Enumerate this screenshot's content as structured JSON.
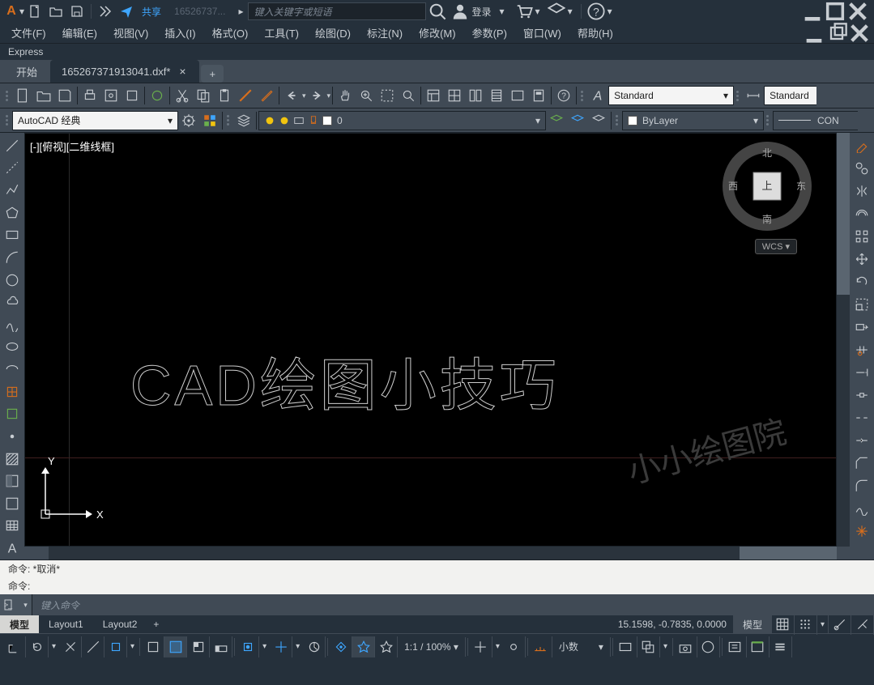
{
  "top": {
    "share": "共享",
    "filename": "16526737...",
    "search_placeholder": "键入关键字或短语",
    "login": "登录"
  },
  "menu": {
    "file": "文件(F)",
    "edit": "编辑(E)",
    "view": "视图(V)",
    "insert": "插入(I)",
    "format": "格式(O)",
    "tools": "工具(T)",
    "draw": "绘图(D)",
    "dimension": "标注(N)",
    "modify": "修改(M)",
    "parametric": "参数(P)",
    "window": "窗口(W)",
    "help": "帮助(H)"
  },
  "express": "Express",
  "tabs": {
    "start": "开始",
    "active": "165267371913041.dxf*"
  },
  "styles": {
    "text": "Standard",
    "dim": "Standard"
  },
  "workspace": "AutoCAD 经典",
  "layer": "0",
  "bylayer": "ByLayer",
  "linetype": "CON",
  "view": {
    "label": "[-][俯视][二维线框]",
    "north": "北",
    "south": "南",
    "east": "东",
    "west": "西",
    "top": "上",
    "x": "X",
    "y": "Y",
    "wcs": "WCS ▾"
  },
  "canvas_text": "CAD绘图小技巧",
  "watermark": "小小绘图院",
  "cmd": {
    "l1": "命令:  *取消*",
    "l2": "命令:",
    "placeholder": "键入命令"
  },
  "layouts": {
    "model": "模型",
    "l1": "Layout1",
    "l2": "Layout2"
  },
  "coords": "15.1598, -0.7835, 0.0000",
  "status": {
    "model": "模型",
    "scale": "1:1 / 100% ▾",
    "dec": "小数"
  }
}
